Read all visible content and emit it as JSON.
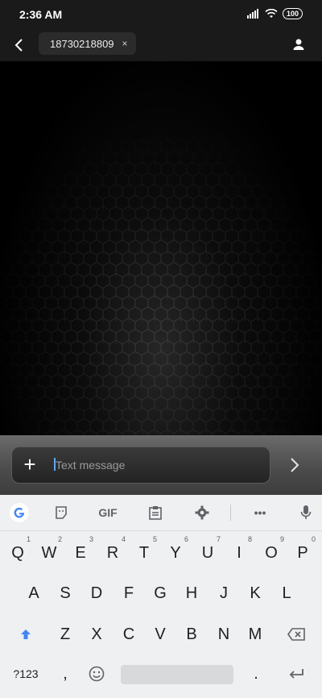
{
  "status_bar": {
    "time": "2:36 AM",
    "battery": "100"
  },
  "header": {
    "recipient": "18730218809",
    "chip_close": "×"
  },
  "compose": {
    "placeholder": "Text message"
  },
  "keyboard": {
    "toolbar": {
      "gif": "GIF",
      "more": "•••"
    },
    "row1": [
      {
        "key": "Q",
        "hint": "1"
      },
      {
        "key": "W",
        "hint": "2"
      },
      {
        "key": "E",
        "hint": "3"
      },
      {
        "key": "R",
        "hint": "4"
      },
      {
        "key": "T",
        "hint": "5"
      },
      {
        "key": "Y",
        "hint": "6"
      },
      {
        "key": "U",
        "hint": "7"
      },
      {
        "key": "I",
        "hint": "8"
      },
      {
        "key": "O",
        "hint": "9"
      },
      {
        "key": "P",
        "hint": "0"
      }
    ],
    "row2": [
      "A",
      "S",
      "D",
      "F",
      "G",
      "H",
      "J",
      "K",
      "L"
    ],
    "row3": [
      "Z",
      "X",
      "C",
      "V",
      "B",
      "N",
      "M"
    ],
    "bottom": {
      "symbols": "?123",
      "comma": ",",
      "period": "."
    }
  }
}
